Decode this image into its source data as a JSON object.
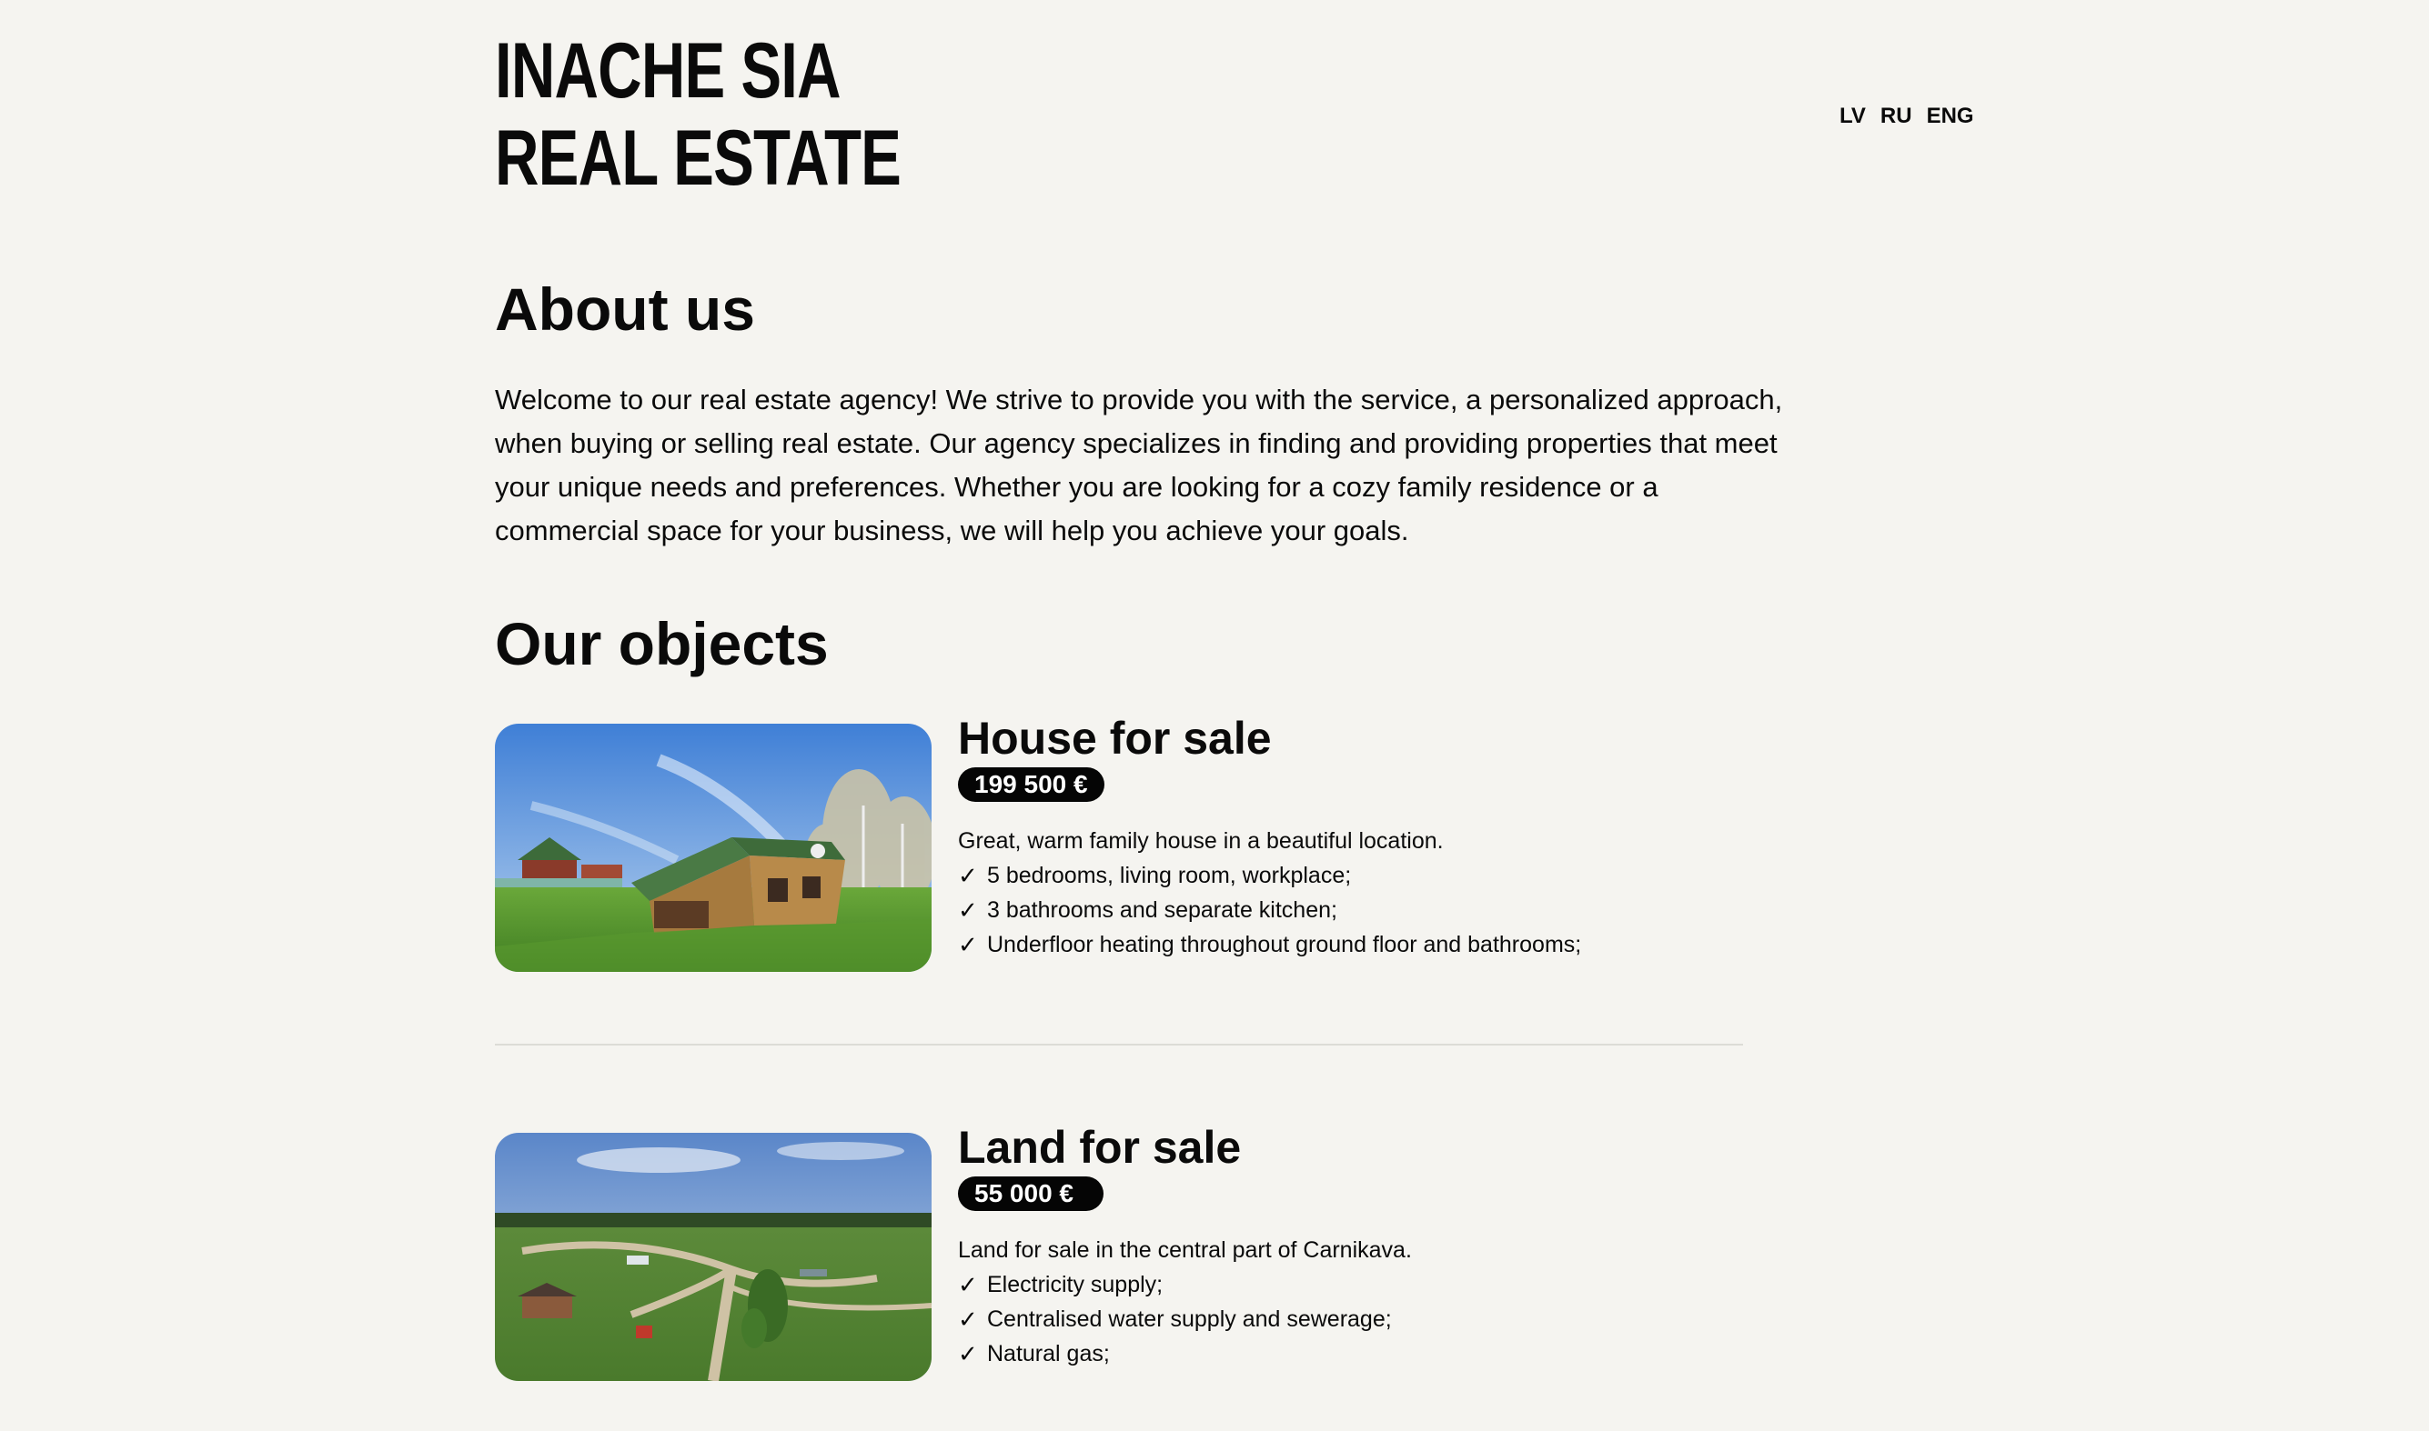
{
  "header": {
    "logo_line1": "INACHE SIA",
    "logo_line2": "REAL ESTATE",
    "languages": [
      "LV",
      "RU",
      "ENG"
    ]
  },
  "about": {
    "title": "About us",
    "text": "Welcome to our real estate agency! We strive to provide you with the service, a personalized approach, when buying or selling real estate. Our agency specializes in finding and providing properties that meet your unique needs and preferences. Whether you are looking for a cozy family residence or a commercial space for your business, we will help you achieve your goals."
  },
  "objects": {
    "title": "Our objects",
    "check_symbol": "✓",
    "items": [
      {
        "title": "House for sale",
        "price": "199 500 €",
        "description": "Great, warm family house in a beautiful location.",
        "features": [
          "5 bedrooms, living room, workplace;",
          "3 bathrooms and separate kitchen;",
          "Underfloor heating throughout ground floor and bathrooms;"
        ]
      },
      {
        "title": "Land for sale",
        "price": "55 000 €",
        "description": "Land for sale in the central part of Carnikava.",
        "features": [
          "Electricity supply;",
          "Centralised water supply and sewerage;",
          "Natural gas;"
        ]
      }
    ]
  },
  "colors": {
    "background": "#f5f4f0",
    "text": "#0a0a0a",
    "price_badge": "#050505",
    "divider": "#dcdcd6"
  }
}
